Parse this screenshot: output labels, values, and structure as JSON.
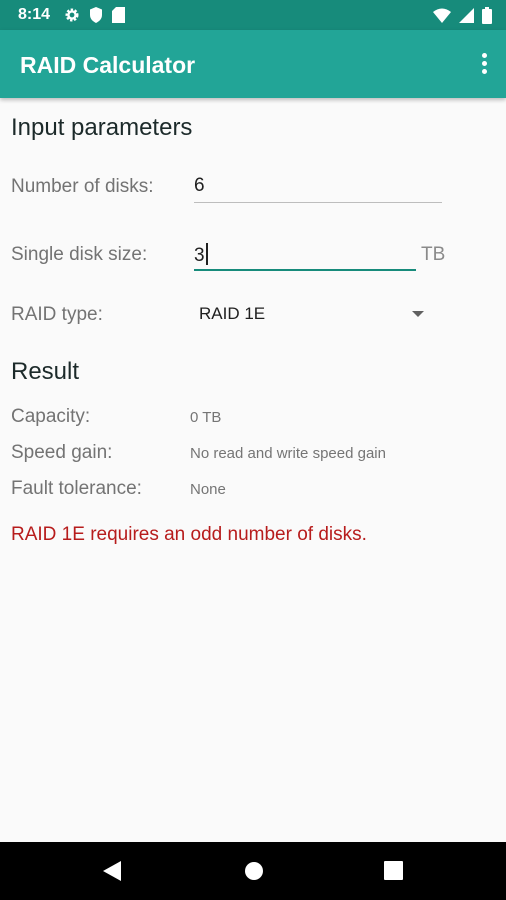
{
  "status_bar": {
    "time": "8:14",
    "icons_left": [
      "gear-icon",
      "shield-icon",
      "sd-card-icon"
    ],
    "icons_right": [
      "wifi-icon",
      "signal-icon",
      "battery-icon"
    ]
  },
  "app_bar": {
    "title": "RAID Calculator",
    "menu_icon": "overflow-menu-icon"
  },
  "input_section": {
    "title": "Input parameters",
    "disks_label": "Number of disks:",
    "disks_value": "6",
    "size_label": "Single disk size:",
    "size_value": "3",
    "size_unit": "TB",
    "raid_label": "RAID type:",
    "raid_value": "RAID 1E"
  },
  "result_section": {
    "title": "Result",
    "capacity_label": "Capacity:",
    "capacity_value": "0 TB",
    "speed_label": "Speed gain:",
    "speed_value": "No read and write speed gain",
    "fault_label": "Fault tolerance:",
    "fault_value": "None"
  },
  "error_message": "RAID 1E requires an odd number of disks.",
  "colors": {
    "status_bar": "#178b7b",
    "app_bar": "#22a597",
    "accent": "#178b7b",
    "error": "#b71c1c"
  },
  "nav_bar": {
    "icons": [
      "back-icon",
      "home-icon",
      "recents-icon"
    ]
  }
}
